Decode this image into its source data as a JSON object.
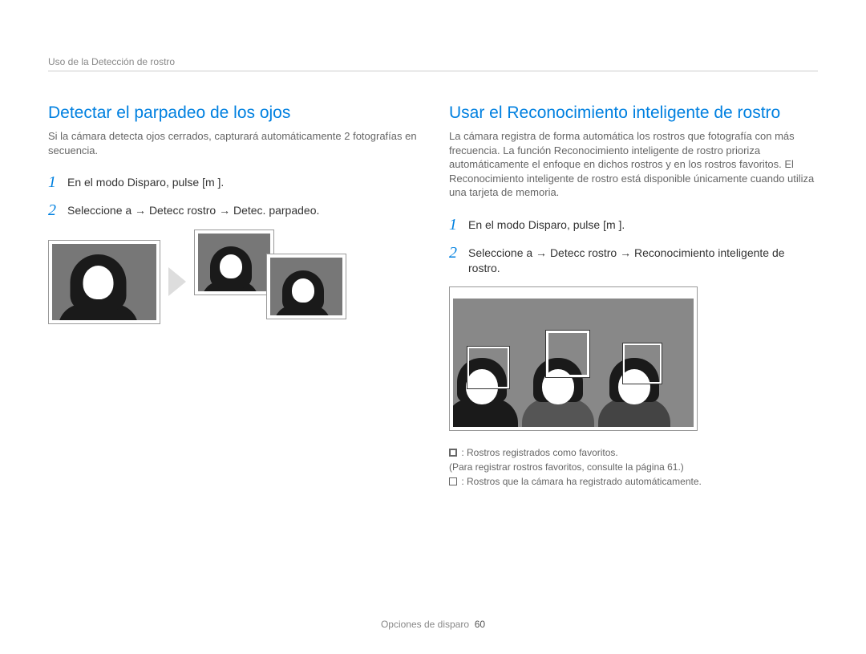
{
  "breadcrumb": "Uso de la Detección de rostro",
  "left": {
    "title": "Detectar el parpadeo de los ojos",
    "intro": "Si la cámara detecta ojos cerrados, capturará automáticamente 2 fotografías en secuencia.",
    "step1": "En el modo Disparo, pulse [m        ].",
    "step2": "Seleccione a      → Detecc rostro → Detec. parpadeo."
  },
  "right": {
    "title": "Usar el Reconocimiento inteligente de rostro",
    "intro": "La cámara registra de forma automática los rostros que fotografía con más frecuencia. La función Reconocimiento inteligente de rostro prioriza automáticamente el enfoque en dichos rostros y en los rostros favoritos. El Reconocimiento inteligente de rostro está disponible únicamente cuando utiliza una tarjeta de memoria.",
    "step1": "En el modo Disparo, pulse [m        ].",
    "step2": "Seleccione a      → Detecc rostro → Reconocimiento inteligente de rostro.",
    "legend1": ": Rostros registrados como favoritos.",
    "legend1b": "(Para registrar rostros favoritos, consulte la página 61.)",
    "legend2": ": Rostros que la cámara ha registrado automáticamente."
  },
  "footer": {
    "section": "Opciones de disparo",
    "page": "60"
  },
  "nums": {
    "one": "1",
    "two": "2"
  }
}
